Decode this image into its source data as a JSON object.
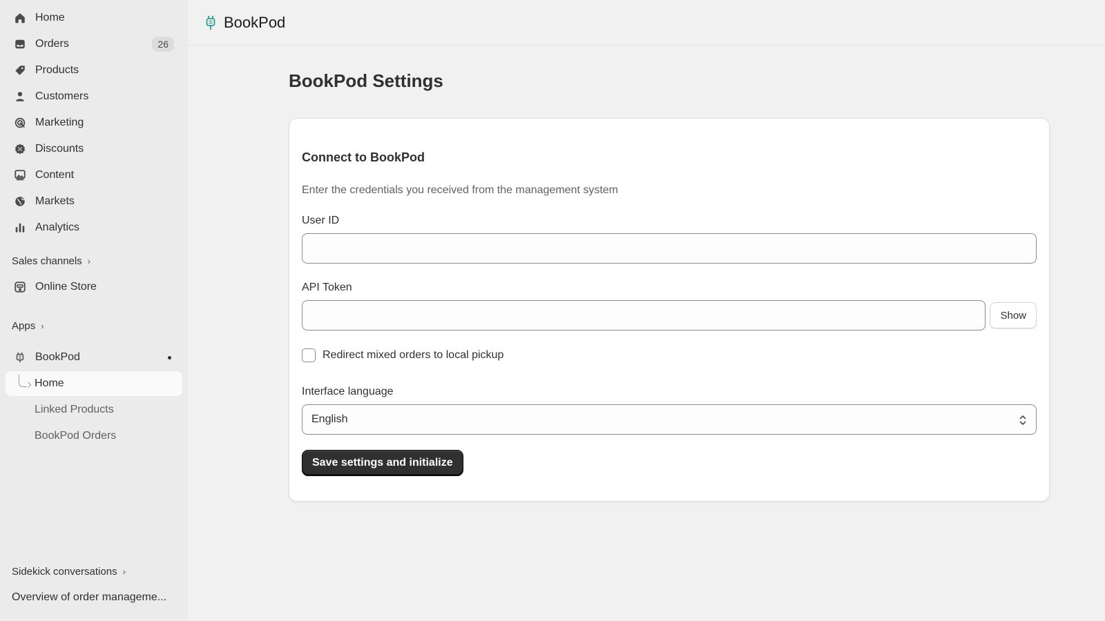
{
  "sidebar": {
    "nav": [
      {
        "label": "Home",
        "icon": "home-icon"
      },
      {
        "label": "Orders",
        "icon": "inbox-icon",
        "badge": "26"
      },
      {
        "label": "Products",
        "icon": "tag-icon"
      },
      {
        "label": "Customers",
        "icon": "person-icon"
      },
      {
        "label": "Marketing",
        "icon": "target-icon"
      },
      {
        "label": "Discounts",
        "icon": "discount-icon"
      },
      {
        "label": "Content",
        "icon": "image-icon"
      },
      {
        "label": "Markets",
        "icon": "globe-icon"
      },
      {
        "label": "Analytics",
        "icon": "bar-chart-icon"
      }
    ],
    "sales_channels": {
      "header": "Sales channels",
      "items": [
        {
          "label": "Online Store",
          "icon": "store-icon"
        }
      ]
    },
    "apps": {
      "header": "Apps",
      "app_name": "BookPod",
      "sub_items": [
        "Home",
        "Linked Products",
        "BookPod Orders"
      ]
    },
    "sidekick": {
      "header": "Sidekick conversations",
      "conversation": "Overview of order manageme..."
    }
  },
  "topbar": {
    "app_title": "BookPod"
  },
  "page": {
    "title": "BookPod Settings"
  },
  "form": {
    "heading": "Connect to BookPod",
    "description": "Enter the credentials you received from the management system",
    "user_id_label": "User ID",
    "user_id_value": "",
    "api_token_label": "API Token",
    "api_token_value": "",
    "show_label": "Show",
    "redirect_label": "Redirect mixed orders to local pickup",
    "redirect_checked": false,
    "language_label": "Interface language",
    "language_value": "English",
    "submit_label": "Save settings and initialize"
  },
  "colors": {
    "sidebar_bg": "#ebebeb",
    "page_bg": "#f1f1f1",
    "primary_button": "#303030",
    "app_accent": "#2a9d8f"
  }
}
